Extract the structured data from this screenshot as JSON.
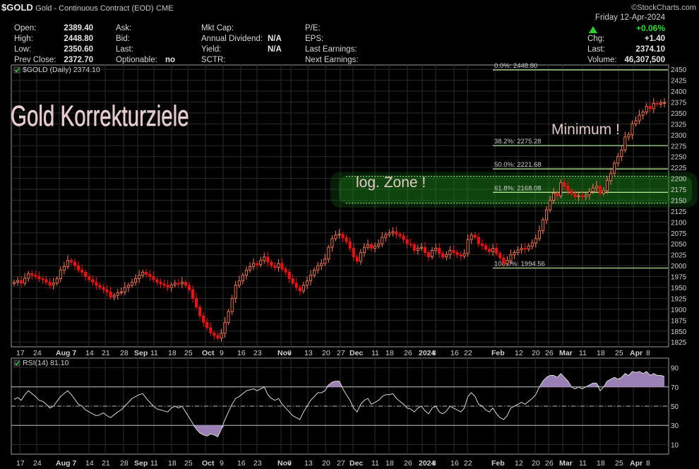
{
  "header": {
    "symbol": "$GOLD",
    "name": "Gold - Continuous Contract (EOD)",
    "exchange": "CME",
    "watermark": "©StockCharts.com",
    "date": "Friday  12-Apr-2024"
  },
  "quote": {
    "open_label": "Open:",
    "open": "2389.40",
    "high_label": "High:",
    "high": "2448.80",
    "low_label": "Low:",
    "low": "2350.60",
    "prev_close_label": "Prev Close:",
    "prev_close": "2372.70",
    "ask_label": "Ask:",
    "bid_label": "Bid:",
    "last_label": "Last:",
    "optionable_label": "Optionable:",
    "optionable": "no",
    "mkt_cap_label": "Mkt Cap:",
    "annual_dividend_label": "Annual Dividend:",
    "annual_dividend": "N/A",
    "yield_label": "Yield:",
    "yield": "N/A",
    "sctr_label": "SCTR:",
    "pe_label": "P/E:",
    "eps_label": "EPS:",
    "last_earnings_label": "Last Earnings:",
    "next_earnings_label": "Next Earnings:",
    "change_pct": "+0.06%",
    "chg_label": "Chg:",
    "chg": "+1.40",
    "last_label2": "Last:",
    "last": "2374.10",
    "volume_label": "Volume:",
    "volume": "46,307,500"
  },
  "colors": {
    "up": "#2bd12b",
    "candle_down": "#ee1111",
    "candle_up": "#ff7a55",
    "fib": "#b0e090",
    "zone": "#1e8a1e",
    "rsi_fill": "#9a80b4",
    "grid": "#2b2b2b"
  },
  "chart_data": [
    {
      "type": "candlestick",
      "legend": "$GOLD (Daily) 2374.10",
      "annotation_title": "Gold Korrekturziele",
      "annotation_zone": "log. Zone !",
      "annotation_min": "Minimum !",
      "ylim": [
        1814,
        2460
      ],
      "yticks": [
        1825,
        1850,
        1875,
        1900,
        1925,
        1950,
        1975,
        2000,
        2025,
        2050,
        2075,
        2100,
        2125,
        2150,
        2175,
        2200,
        2225,
        2250,
        2275,
        2300,
        2325,
        2350,
        2375,
        2400,
        2425,
        2450
      ],
      "xticks": [
        "17",
        "24",
        "Aug 7",
        "14",
        "21",
        "28",
        "Sep",
        "11",
        "18",
        "25",
        "Oct",
        "9",
        "16",
        "23",
        "Nov",
        "6",
        "13",
        "20",
        "27",
        "Dec",
        "11",
        "18",
        "26",
        "2024",
        "8",
        "16",
        "22",
        "Feb",
        "12",
        "20",
        "26",
        "Mar",
        "11",
        "18",
        "25",
        "Apr",
        "8"
      ],
      "x_dates_first": "2023-07-14",
      "x_dates_last": "2024-04-12",
      "close": [
        1962,
        1966,
        1960,
        1971,
        1982,
        1978,
        1975,
        1970,
        1968,
        1962,
        1955,
        1960,
        1970,
        1990,
        1998,
        2012,
        2008,
        2000,
        1990,
        1985,
        1975,
        1968,
        1962,
        1955,
        1950,
        1945,
        1940,
        1928,
        1932,
        1938,
        1940,
        1950,
        1955,
        1962,
        1970,
        1978,
        1985,
        1980,
        1975,
        1968,
        1962,
        1958,
        1955,
        1950,
        1956,
        1960,
        1958,
        1962,
        1955,
        1945,
        1925,
        1905,
        1885,
        1870,
        1858,
        1846,
        1840,
        1834,
        1845,
        1870,
        1895,
        1925,
        1955,
        1965,
        1978,
        1990,
        1998,
        2005,
        2002,
        2012,
        2020,
        2008,
        2000,
        1996,
        2005,
        1992,
        1985,
        1970,
        1960,
        1950,
        1942,
        1955,
        1965,
        1978,
        1990,
        2000,
        2005,
        2015,
        2042,
        2062,
        2070,
        2072,
        2064,
        2055,
        2040,
        2020,
        2010,
        2030,
        2042,
        2048,
        2040,
        2045,
        2050,
        2065,
        2071,
        2075,
        2078,
        2072,
        2068,
        2060,
        2050,
        2048,
        2035,
        2040,
        2042,
        2030,
        2020,
        2035,
        2040,
        2028,
        2020,
        2025,
        2035,
        2030,
        2025,
        2022,
        2028,
        2060,
        2070,
        2065,
        2050,
        2046,
        2038,
        2032,
        2040,
        2028,
        2018,
        2005,
        2012,
        2025,
        2030,
        2036,
        2040,
        2038,
        2045,
        2052,
        2062,
        2080,
        2105,
        2128,
        2150,
        2166,
        2160,
        2190,
        2182,
        2172,
        2165,
        2158,
        2160,
        2158,
        2162,
        2170,
        2178,
        2182,
        2166,
        2172,
        2195,
        2212,
        2235,
        2250,
        2265,
        2295,
        2300,
        2325,
        2332,
        2345,
        2352,
        2365,
        2360,
        2372,
        2370,
        2373,
        2374
      ],
      "fib_levels": [
        {
          "label": "0.0%: 2448.80",
          "value": 2448.8
        },
        {
          "label": "38.2%: 2275.28",
          "value": 2275.28
        },
        {
          "label": "50.0%: 2221.68",
          "value": 2221.68
        },
        {
          "label": "61.8%: 2168.08",
          "value": 2168.08
        },
        {
          "label": "100.0%: 1994.56",
          "value": 1994.56
        }
      ],
      "zone": [
        2143,
        2205
      ]
    },
    {
      "type": "line",
      "legend": "RSI(14) 81.10",
      "ylim": [
        0,
        100
      ],
      "yticks": [
        10,
        30,
        50,
        70,
        90
      ],
      "overbought": 70,
      "oversold": 30,
      "midline": 50,
      "values": [
        57,
        59,
        56,
        62,
        66,
        63,
        60,
        56,
        55,
        52,
        48,
        50,
        55,
        60,
        63,
        66,
        62,
        57,
        52,
        50,
        46,
        44,
        42,
        40,
        41,
        43,
        40,
        38,
        41,
        44,
        46,
        50,
        54,
        58,
        60,
        62,
        63,
        58,
        54,
        50,
        47,
        46,
        45,
        44,
        48,
        50,
        48,
        50,
        44,
        38,
        32,
        26,
        22,
        20,
        19,
        21,
        20,
        18,
        26,
        36,
        44,
        52,
        58,
        60,
        63,
        66,
        67,
        68,
        66,
        68,
        70,
        62,
        58,
        56,
        58,
        52,
        48,
        44,
        40,
        38,
        36,
        44,
        50,
        56,
        60,
        64,
        64,
        66,
        72,
        75,
        76,
        76,
        68,
        62,
        56,
        48,
        44,
        52,
        56,
        58,
        52,
        54,
        56,
        60,
        62,
        62,
        63,
        58,
        55,
        52,
        48,
        47,
        44,
        48,
        50,
        45,
        42,
        48,
        50,
        44,
        42,
        45,
        50,
        48,
        46,
        44,
        48,
        60,
        64,
        60,
        52,
        50,
        46,
        44,
        48,
        42,
        38,
        36,
        40,
        48,
        50,
        52,
        54,
        52,
        55,
        58,
        62,
        70,
        76,
        80,
        82,
        82,
        80,
        84,
        80,
        76,
        70,
        68,
        70,
        68,
        70,
        72,
        74,
        74,
        66,
        70,
        76,
        78,
        80,
        78,
        80,
        84,
        82,
        86,
        85,
        86,
        84,
        86,
        82,
        84,
        82,
        82,
        81
      ],
      "x_dates_first": "2023-07-14",
      "x_dates_last": "2024-04-12"
    }
  ]
}
